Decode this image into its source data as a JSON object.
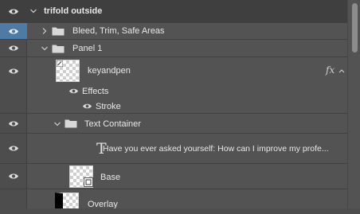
{
  "rows": [
    {
      "id": "trifold",
      "label": "trifold outside"
    },
    {
      "id": "bleed",
      "label": "Bleed, Trim, Safe Areas"
    },
    {
      "id": "panel1",
      "label": "Panel 1"
    },
    {
      "id": "keyandpen",
      "label": "keyandpen",
      "fx": "fx"
    },
    {
      "id": "effects",
      "label": "Effects"
    },
    {
      "id": "stroke",
      "label": "Stroke"
    },
    {
      "id": "textcontainer",
      "label": "Text Container"
    },
    {
      "id": "textlayer",
      "type_glyph": "T",
      "label": "Have you ever asked yourself:  How can I improve my  profe..."
    },
    {
      "id": "base",
      "label": "Base"
    },
    {
      "id": "overlay",
      "label": "Overlay"
    }
  ],
  "colors": {
    "panel_bg": "#535353",
    "selected_eye": "#4e7aa4",
    "header_row": "#3f3f3f",
    "text": "#e8e8e8"
  },
  "icons": {
    "visibility": "eye-icon",
    "expand": "chevron-icon",
    "folder": "folder-icon",
    "text_layer": "type-icon",
    "fx": "fx-icon"
  }
}
